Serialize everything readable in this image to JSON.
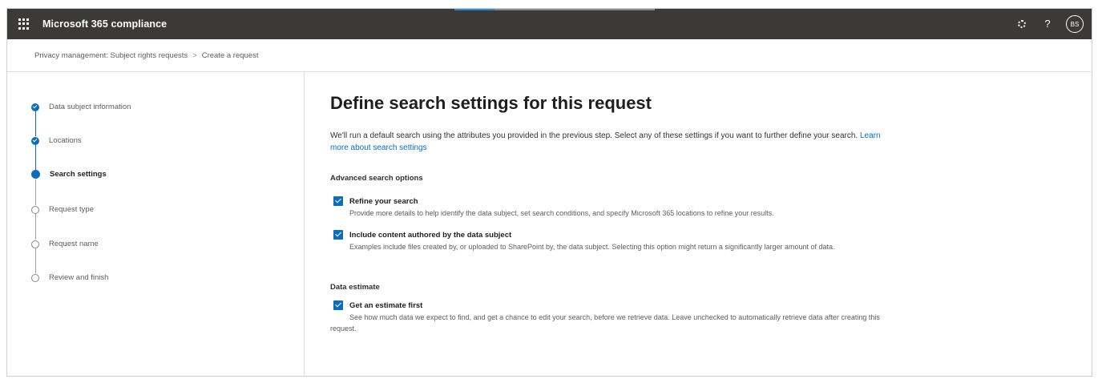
{
  "topbar": {
    "app_title": "Microsoft 365 compliance",
    "avatar_initials": "BS",
    "help_glyph": "?"
  },
  "breadcrumb": {
    "parent": "Privacy management: Subject rights requests",
    "separator": ">",
    "current": "Create a request"
  },
  "steps": [
    {
      "label": "Data subject information",
      "state": "done"
    },
    {
      "label": "Locations",
      "state": "done"
    },
    {
      "label": "Search settings",
      "state": "current"
    },
    {
      "label": "Request type",
      "state": "todo"
    },
    {
      "label": "Request name",
      "state": "todo"
    },
    {
      "label": "Review and finish",
      "state": "todo"
    }
  ],
  "main": {
    "title": "Define search settings for this request",
    "description": "We'll run a default search using the attributes you provided in the previous step. Select any of these settings if you want to further define your search.",
    "learn_more": "Learn more about search settings",
    "advanced_label": "Advanced search options",
    "options": [
      {
        "label": "Refine your search",
        "checked": true,
        "description": "Provide more details to help identify the data subject, set search conditions, and specify Microsoft 365 locations to refine your results."
      },
      {
        "label": "Include content authored by the data subject",
        "checked": true,
        "description": "Examples include files created by, or uploaded to SharePoint by, the data subject. Selecting this option might return a significantly larger amount of data."
      }
    ],
    "estimate_label": "Data estimate",
    "estimate_option": {
      "label": "Get an estimate first",
      "checked": true,
      "description": "See how much data we expect to find, and get a chance to edit your search, before we retrieve data. Leave unchecked to automatically retrieve data after creating this request."
    }
  },
  "colors": {
    "topbar": "#3b3a39",
    "accent": "#0f6cbd"
  }
}
